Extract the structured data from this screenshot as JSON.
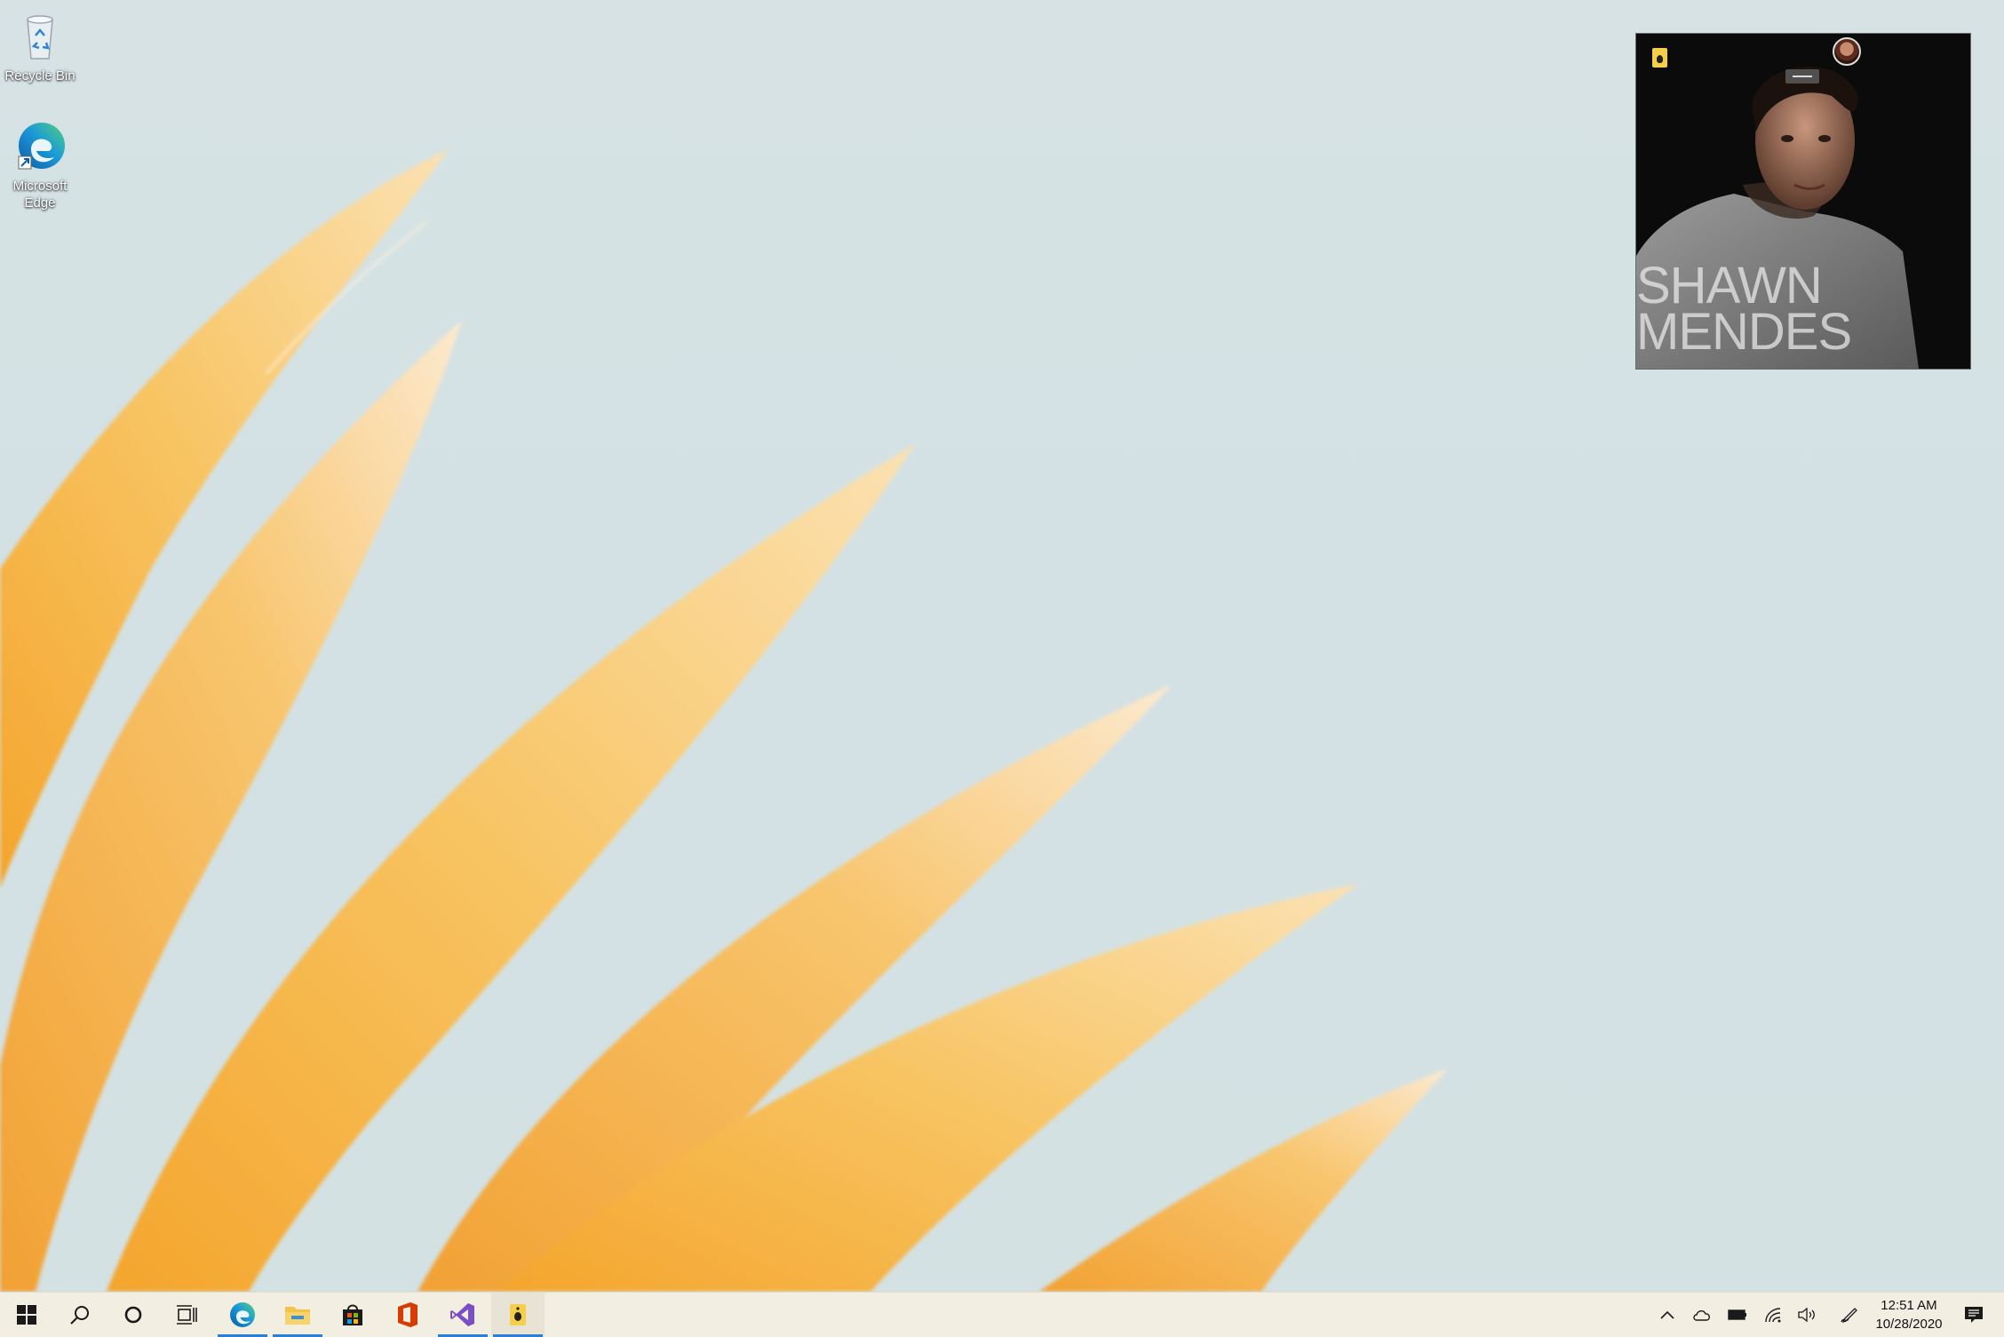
{
  "desktop": {
    "wallpaper": "yellow-petals",
    "icons": [
      {
        "name": "recycle-bin",
        "label": "Recycle Bin",
        "icon": "recycle-bin-icon"
      },
      {
        "name": "microsoft-edge",
        "label": "Microsoft Edge",
        "icon": "edge-icon"
      }
    ]
  },
  "media_widget": {
    "title": "SHAWN\nMENDES",
    "app_icon": "music-app-icon",
    "handle": "drag-handle-icon",
    "avatar": "user-avatar"
  },
  "taskbar": {
    "start": "windows-start-icon",
    "search": "search-icon",
    "cortana": "cortana-icon",
    "task_view": "task-view-icon",
    "pinned": [
      {
        "name": "taskbar-edge",
        "icon": "edge-icon",
        "running": true
      },
      {
        "name": "taskbar-file-explorer",
        "icon": "folder-icon",
        "running": true
      },
      {
        "name": "taskbar-store",
        "icon": "store-icon",
        "running": false
      },
      {
        "name": "taskbar-office",
        "icon": "office-icon",
        "running": false
      },
      {
        "name": "taskbar-visual-studio",
        "icon": "visual-studio-icon",
        "running": true
      },
      {
        "name": "taskbar-music-app",
        "icon": "music-app-icon",
        "running": true,
        "active": true
      }
    ],
    "tray": {
      "show_hidden": "chevron-up-icon",
      "onedrive": "cloud-icon",
      "battery": "battery-icon",
      "network": "wifi-icon",
      "volume": "volume-icon",
      "pen": "pen-icon",
      "notifications": "notification-icon"
    },
    "clock": {
      "time": "12:51 AM",
      "date": "10/28/2020"
    }
  },
  "colors": {
    "taskbar_bg": "#f3eee2",
    "accent": "#2a7fd5",
    "petal": "#f7b84c"
  }
}
